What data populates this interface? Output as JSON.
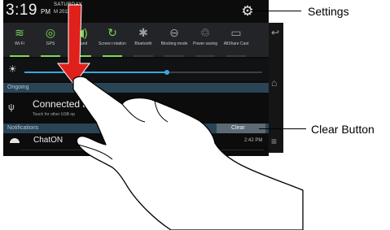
{
  "status": {
    "clock": "3:19",
    "ampm": "PM",
    "day": "SATURDAY",
    "date": "M  2013"
  },
  "toggles": [
    {
      "label": "Wi-Fi",
      "icon": "wifi-icon",
      "glyph": "≋",
      "on": true
    },
    {
      "label": "GPS",
      "icon": "gps-icon",
      "glyph": "◎",
      "on": true
    },
    {
      "label": "Sound",
      "icon": "sound-icon",
      "glyph": "◀)",
      "on": true
    },
    {
      "label": "Screen rotation",
      "icon": "screen-rotation-icon",
      "glyph": "↻",
      "on": true
    },
    {
      "label": "Bluetooth",
      "icon": "bluetooth-icon",
      "glyph": "✱",
      "on": false
    },
    {
      "label": "Blocking mode",
      "icon": "blocking-mode-icon",
      "glyph": "⊖",
      "on": false
    },
    {
      "label": "Power saving",
      "icon": "power-saving-icon",
      "glyph": "♲",
      "on": false
    },
    {
      "label": "AllShare Cast",
      "icon": "allshare-cast-icon",
      "glyph": "▭",
      "on": false
    }
  ],
  "brightness": {
    "level": 0.6,
    "color": "#36a9e1"
  },
  "sections": {
    "ongoing": "Ongoing",
    "notifications": "Notifications",
    "clear": "Clear"
  },
  "usb": {
    "title": "Connected as a",
    "subtitle": "Touch for other USB op"
  },
  "chaton": {
    "title": "ChatON",
    "time": "2:42 PM"
  },
  "callouts": {
    "settings": "Settings",
    "clear_button": "Clear Button"
  },
  "colors": {
    "toggle_on": "#7ed957",
    "header_bg": "#2a4456",
    "arrow": "#e0201b"
  }
}
